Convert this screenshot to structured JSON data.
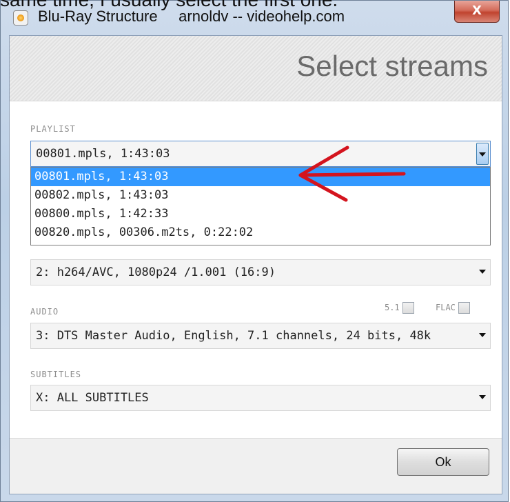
{
  "caption": "same time, I usually select the first one.",
  "window": {
    "title": "Blu-Ray Structure     arnoldv -- videohelp.com",
    "close_label": "X"
  },
  "header": {
    "title": "Select streams"
  },
  "playlist": {
    "label": "PLAYLIST",
    "value": "00801.mpls, 1:43:03",
    "options": [
      "00801.mpls, 1:43:03",
      "00802.mpls, 1:43:03",
      "00800.mpls, 1:42:33",
      "00820.mpls, 00306.m2ts, 0:22:02"
    ],
    "selected_index": 0
  },
  "video": {
    "value": "2: h264/AVC, 1080p24 /1.001 (16:9)"
  },
  "audio": {
    "label": "AUDIO",
    "value": "3: DTS Master Audio, English, 7.1 channels, 24 bits, 48k",
    "option_51": "5.1",
    "option_flac": "FLAC"
  },
  "subtitles": {
    "label": "SUBTITLES",
    "value": "X: ALL SUBTITLES"
  },
  "footer": {
    "ok_label": "Ok"
  },
  "colors": {
    "selection": "#3399ff",
    "annotation_arrow": "#d4141e"
  }
}
